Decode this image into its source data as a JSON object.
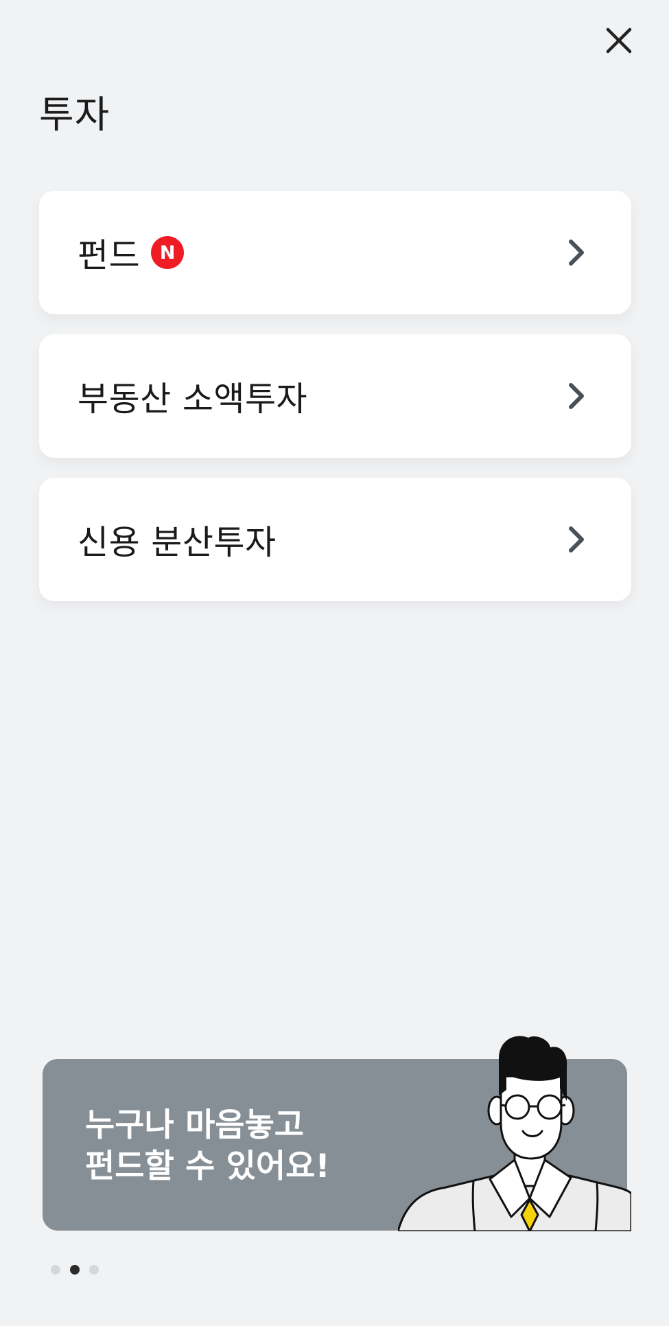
{
  "header": {
    "close_icon": "close-icon",
    "title": "투자"
  },
  "menu": [
    {
      "label": "펀드",
      "badge": "N",
      "badge_color": "#ee1c25",
      "icon": "chevron-right-icon"
    },
    {
      "label": "부동산 소액투자",
      "icon": "chevron-right-icon"
    },
    {
      "label": "신용 분산투자",
      "icon": "chevron-right-icon"
    }
  ],
  "banner": {
    "line1": "누구나 마음놓고",
    "line2": "펀드할 수 있어요!",
    "background": "#878f96",
    "illustration": "character-illustration"
  },
  "pagination": {
    "total": 3,
    "active_index": 1
  },
  "colors": {
    "background": "#f1f2f4",
    "card": "#ffffff",
    "text": "#1a1a1a",
    "chevron": "#4a5058",
    "tie": "#f5d20a"
  }
}
